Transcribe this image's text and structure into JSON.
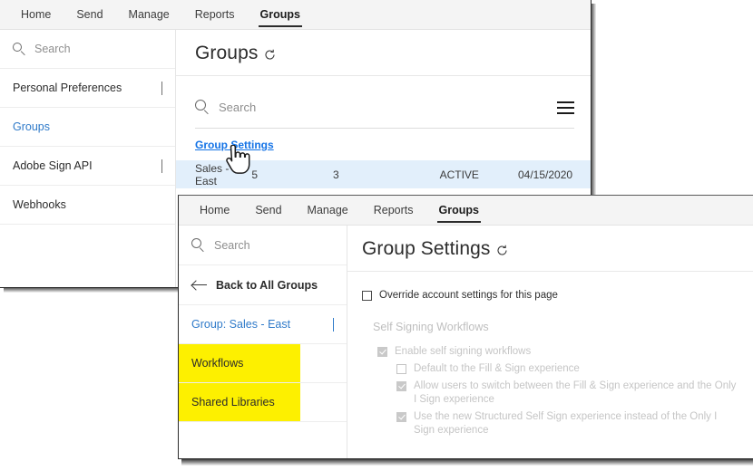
{
  "window1": {
    "nav": {
      "tabs": [
        {
          "label": "Home",
          "active": false
        },
        {
          "label": "Send",
          "active": false
        },
        {
          "label": "Manage",
          "active": false
        },
        {
          "label": "Reports",
          "active": false
        },
        {
          "label": "Groups",
          "active": true
        }
      ]
    },
    "sidebar": {
      "search_placeholder": "Search",
      "items": [
        {
          "label": "Personal Preferences",
          "chevron": true,
          "link": false
        },
        {
          "label": "Groups",
          "chevron": false,
          "link": true
        },
        {
          "label": "Adobe Sign API",
          "chevron": true,
          "link": false
        },
        {
          "label": "Webhooks",
          "chevron": false,
          "link": false
        }
      ]
    },
    "main": {
      "title": "Groups",
      "refresh_icon": "refresh-icon",
      "search_placeholder": "Search",
      "menu_icon": "hamburger-menu-icon",
      "group_settings_link": "Group Settings",
      "row": {
        "name": "Sales - East",
        "users": "5",
        "agreements": "3",
        "status": "ACTIVE",
        "created": "04/15/2020"
      }
    }
  },
  "window2": {
    "nav": {
      "tabs": [
        {
          "label": "Home",
          "active": false
        },
        {
          "label": "Send",
          "active": false
        },
        {
          "label": "Manage",
          "active": false
        },
        {
          "label": "Reports",
          "active": false
        },
        {
          "label": "Groups",
          "active": true
        }
      ]
    },
    "sidebar": {
      "search_placeholder": "Search",
      "back_label": "Back to All Groups",
      "group_selector": "Group: Sales - East",
      "items": [
        {
          "label": "Workflows",
          "highlight": true
        },
        {
          "label": "Shared Libraries",
          "highlight": true
        }
      ]
    },
    "main": {
      "title": "Group Settings",
      "refresh_icon": "refresh-icon",
      "override_label": "Override account settings for this page",
      "section_title": "Self Signing Workflows",
      "checkboxes": [
        {
          "label": "Enable self signing workflows",
          "checked": true,
          "indent": 0
        },
        {
          "label": "Default to the Fill & Sign experience",
          "checked": false,
          "indent": 1
        },
        {
          "label": "Allow users to switch between the Fill & Sign experience and the Only I Sign experience",
          "checked": true,
          "indent": 1
        },
        {
          "label": "Use the new Structured Self Sign experience instead of the Only I Sign experience",
          "checked": true,
          "indent": 1
        }
      ]
    }
  },
  "colors": {
    "accent_link": "#1473e6",
    "sidebar_link": "#2f7ac9",
    "highlight": "#fdf000",
    "row_selected": "#e2effb",
    "navbar_bg": "#f4f4f4"
  }
}
